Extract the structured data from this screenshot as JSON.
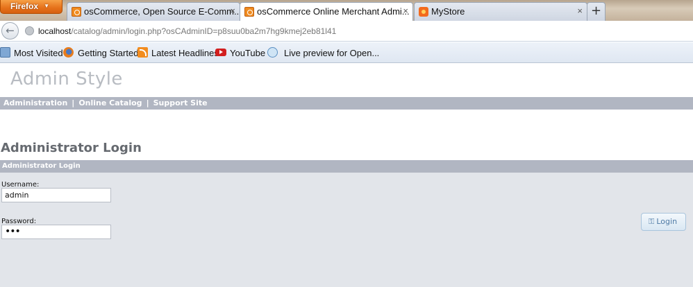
{
  "browser": {
    "menu_label": "Firefox",
    "tabs": [
      {
        "title": "osCommerce, Open Source E-Comm...",
        "icon": "oscommerce-favicon",
        "close": "×"
      },
      {
        "title": "osCommerce Online Merchant Admi...",
        "icon": "oscommerce-favicon",
        "close": "×",
        "active": true
      },
      {
        "title": "MyStore",
        "icon": "store-favicon",
        "close": "×"
      }
    ],
    "new_tab": "+",
    "url_host": "localhost",
    "url_path": "/catalog/admin/login.php?osCAdminID=p8suu0ba2m7hg9kmej2eb81l41",
    "bookmarks": [
      {
        "label": "Most Visited",
        "icon": "most-visited-icon"
      },
      {
        "label": "Getting Started",
        "icon": "firefox-icon"
      },
      {
        "label": "Latest Headlines",
        "icon": "rss-icon"
      },
      {
        "label": "YouTube",
        "icon": "youtube-icon"
      },
      {
        "label": "Live preview for Open...",
        "icon": "live-preview-icon"
      }
    ]
  },
  "page": {
    "logo": "Admin Style",
    "nav": {
      "administration": "Administration",
      "separator": "|",
      "online_catalog": "Online Catalog",
      "support_site": "Support Site"
    },
    "heading": "Administrator Login",
    "panel_title": "Administrator Login",
    "username_label": "Username:",
    "username_value": "admin",
    "password_label": "Password:",
    "password_value": "•••",
    "login_button": "Login",
    "login_icon": "key-icon"
  }
}
